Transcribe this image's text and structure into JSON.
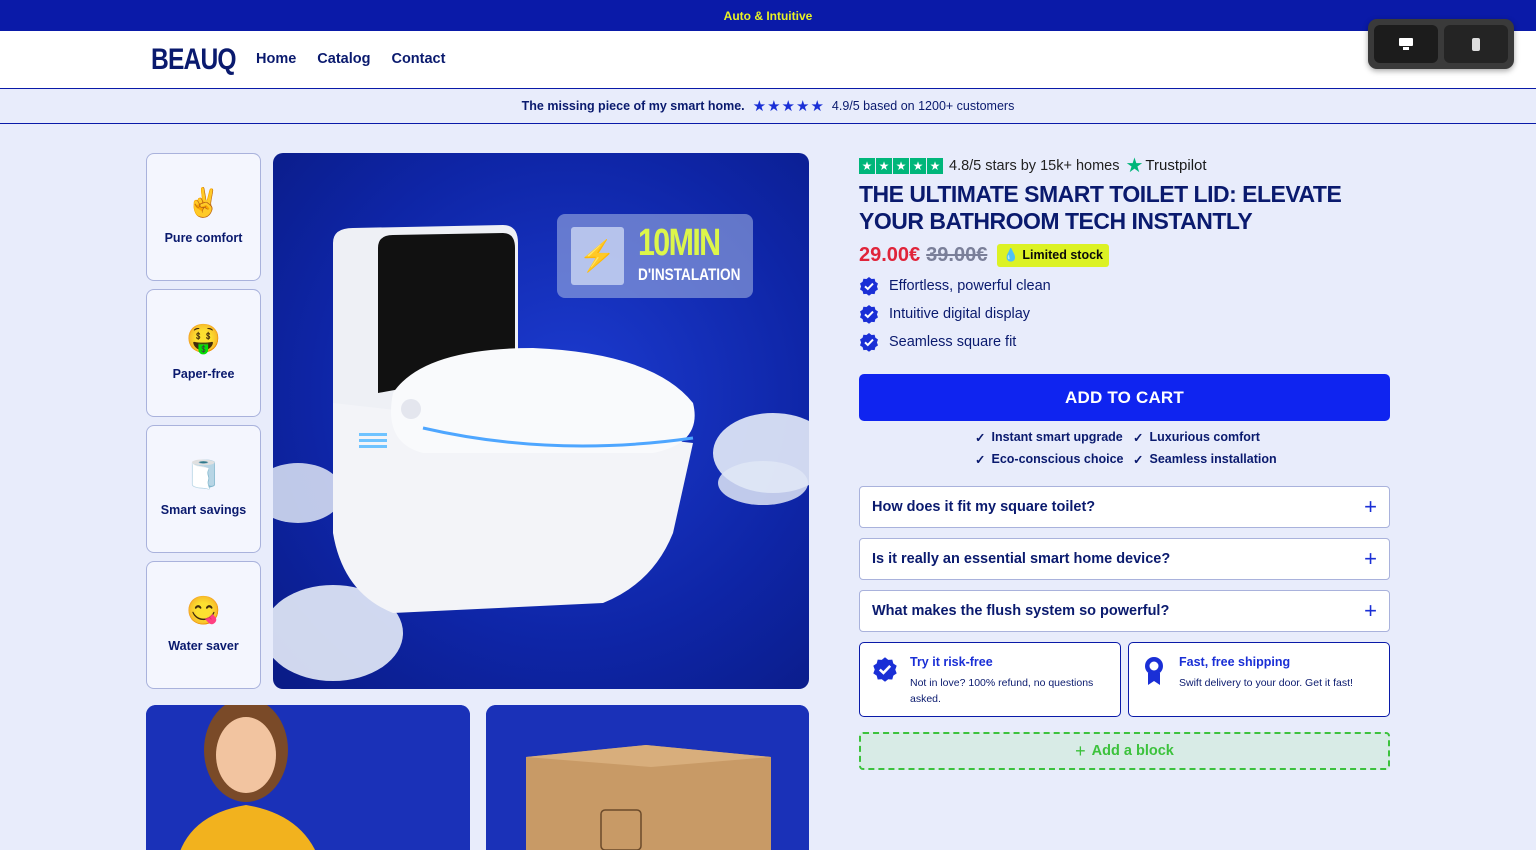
{
  "announcement": "Auto & Intuitive",
  "brand": "BEAUQ",
  "nav": [
    "Home",
    "Catalog",
    "Contact"
  ],
  "view_toggle": {
    "active": "desktop-icon",
    "inactive": "mobile-icon"
  },
  "trust_bar": {
    "quote": "The missing piece of my smart home.",
    "rating_text": "4.9/5 based on 1200+ customers",
    "stars": 5
  },
  "features": [
    {
      "icon": "peace-hand-icon",
      "emoji": "✌️",
      "label": "Pure comfort"
    },
    {
      "icon": "money-mouth-icon",
      "emoji": "🤑",
      "label": "Paper-free"
    },
    {
      "icon": "toilet-paper-icon",
      "emoji": "🧻",
      "label": "Smart savings"
    },
    {
      "icon": "yum-face-icon",
      "emoji": "😋",
      "label": "Water saver"
    }
  ],
  "main_image_badge": {
    "big": "10MIN",
    "small": "D'INSTALATION"
  },
  "product": {
    "rating_text": "4.8/5 stars by 15k+ homes",
    "trustpilot": "Trustpilot",
    "title": "THE ULTIMATE SMART TOILET LID: ELEVATE YOUR BATHROOM TECH INSTANTLY",
    "price": "29.00€",
    "compare_price": "39.00€",
    "stock_badge": "Limited stock",
    "bullets": [
      "Effortless, powerful clean",
      "Intuitive digital display",
      "Seamless square fit"
    ],
    "cart_label": "ADD TO CART",
    "benefits_left": [
      "Instant smart upgrade",
      "Eco-conscious choice"
    ],
    "benefits_right": [
      "Luxurious comfort",
      "Seamless installation"
    ],
    "faq": [
      "How does it fit my square toilet?",
      "Is it really an essential smart home device?",
      "What makes the flush system so powerful?"
    ],
    "guarantees": [
      {
        "title": "Try it risk-free",
        "text": "Not in love? 100% refund, no questions asked."
      },
      {
        "title": "Fast, free shipping",
        "text": "Swift delivery to your door. Get it fast!"
      }
    ],
    "add_block": "Add a block"
  },
  "colors": {
    "primary": "#0f24f0",
    "navy": "#0a1a6e",
    "accent": "#dcf224",
    "price": "#e0243a",
    "trustpilot": "#00b67a"
  }
}
